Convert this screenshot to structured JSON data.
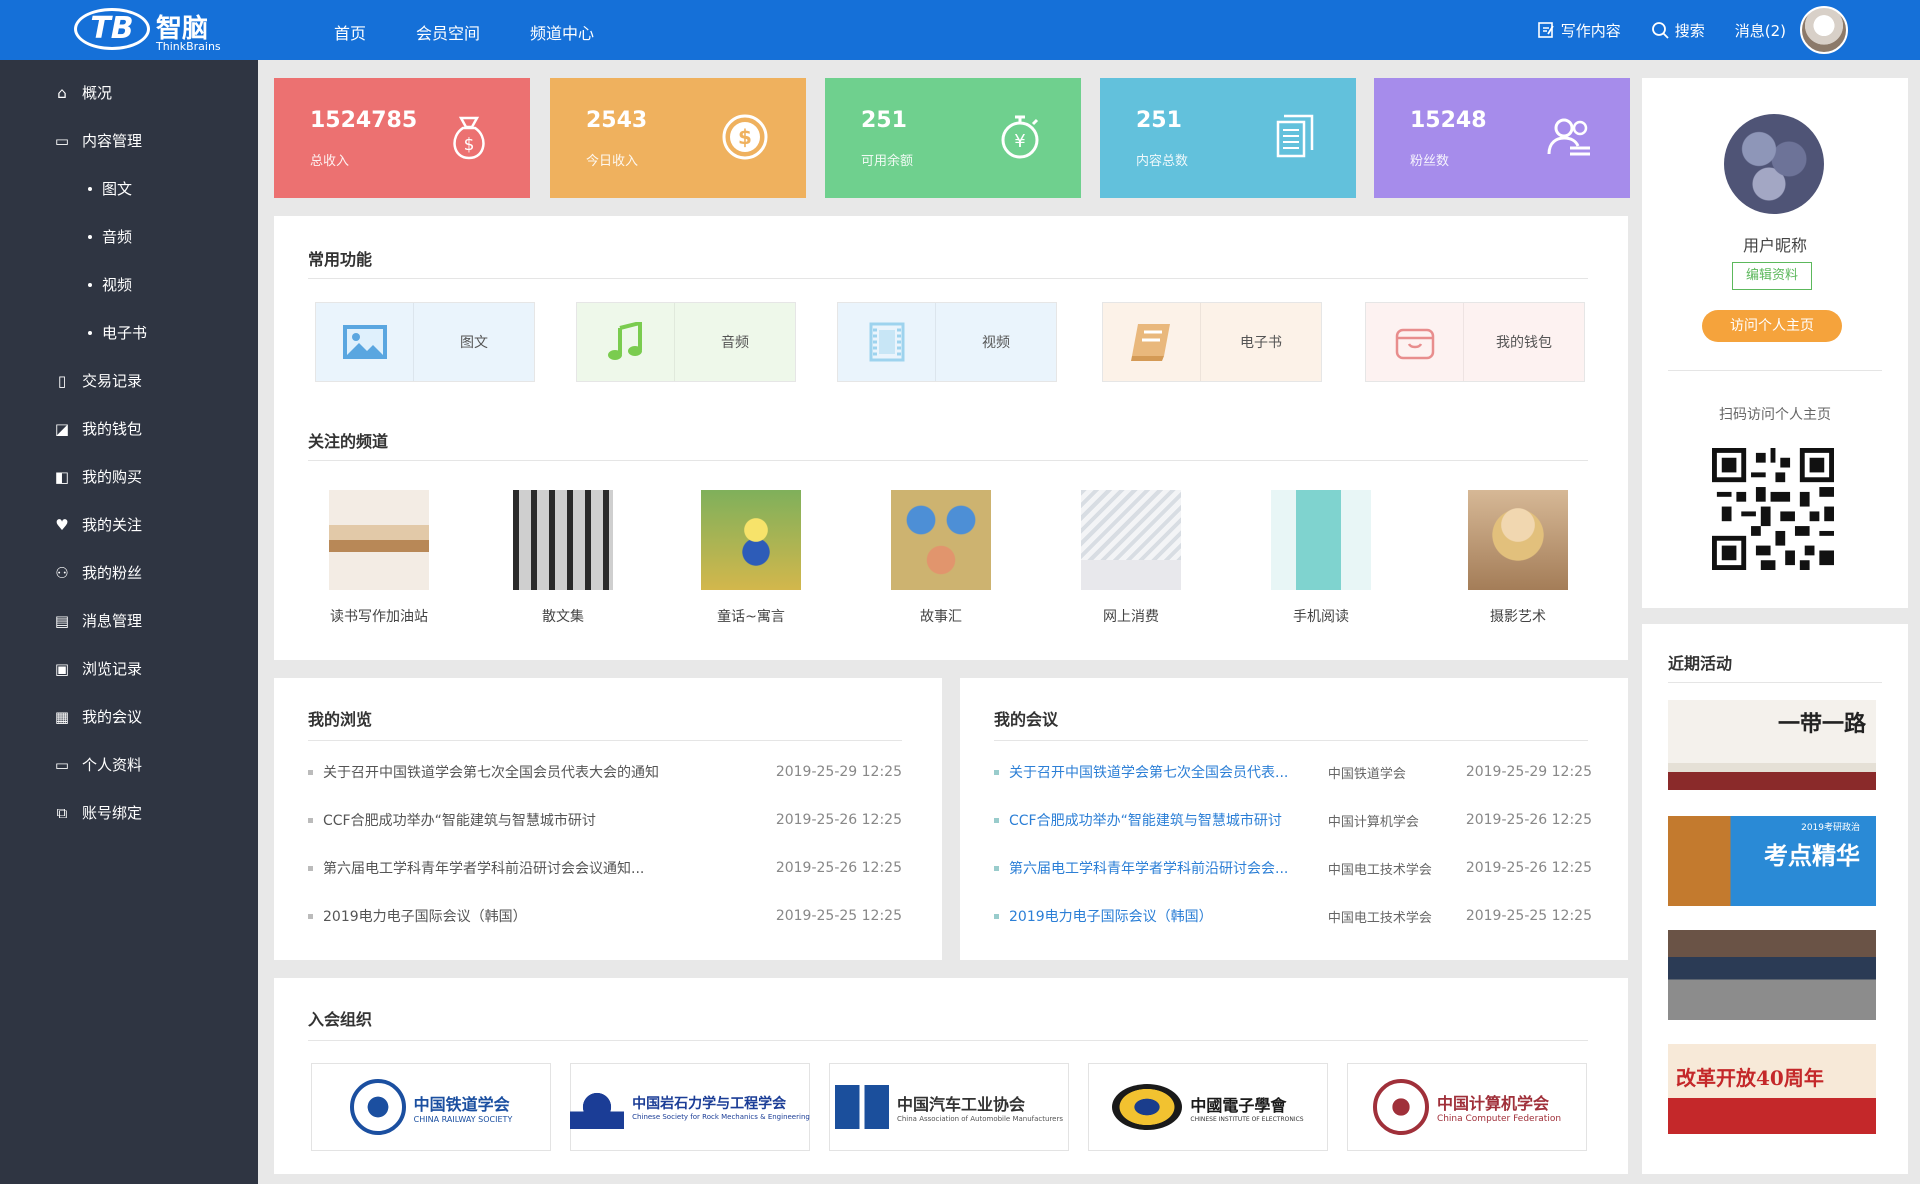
{
  "header": {
    "logo_mark": "TB",
    "logo_cn": "智脑",
    "logo_en": "ThinkBrains",
    "nav": [
      "首页",
      "会员空间",
      "频道中心"
    ],
    "write_label": "写作内容",
    "search_label": "搜索",
    "messages_label": "消息(2)"
  },
  "sidebar": {
    "items": [
      {
        "label": "概况",
        "icon": "home-icon"
      },
      {
        "label": "内容管理",
        "icon": "book-icon"
      },
      {
        "label": "图文",
        "sub": true
      },
      {
        "label": "音频",
        "sub": true
      },
      {
        "label": "视频",
        "sub": true
      },
      {
        "label": "电子书",
        "sub": true
      },
      {
        "label": "交易记录",
        "icon": "receipt-icon"
      },
      {
        "label": "我的钱包",
        "icon": "wallet-icon"
      },
      {
        "label": "我的购买",
        "icon": "purchase-icon"
      },
      {
        "label": "我的关注",
        "icon": "heart-icon"
      },
      {
        "label": "我的粉丝",
        "icon": "fans-icon"
      },
      {
        "label": "消息管理",
        "icon": "message-icon"
      },
      {
        "label": "浏览记录",
        "icon": "history-icon"
      },
      {
        "label": "我的会议",
        "icon": "calendar-icon"
      },
      {
        "label": "个人资料",
        "icon": "id-card-icon"
      },
      {
        "label": "账号绑定",
        "icon": "link-icon"
      }
    ]
  },
  "stats": [
    {
      "value": "1524785",
      "label": "总收入",
      "color": "#ec7171",
      "icon": "money-bag-icon"
    },
    {
      "value": "2543",
      "label": "今日收入",
      "color": "#efb15e",
      "icon": "dollar-coin-icon"
    },
    {
      "value": "251",
      "label": "可用余额",
      "color": "#6fd08e",
      "icon": "yuan-timer-icon"
    },
    {
      "value": "251",
      "label": "内容总数",
      "color": "#62c1dc",
      "icon": "documents-icon"
    },
    {
      "value": "15248",
      "label": "粉丝数",
      "color": "#a68ceb",
      "icon": "users-icon"
    }
  ],
  "functions": {
    "title": "常用功能",
    "items": [
      {
        "label": "图文",
        "icon": "image-icon",
        "bg": "#eaf4fc"
      },
      {
        "label": "音频",
        "icon": "music-icon",
        "bg": "#eef8ea"
      },
      {
        "label": "视频",
        "icon": "film-icon",
        "bg": "#eaf4fc"
      },
      {
        "label": "电子书",
        "icon": "ebook-icon",
        "bg": "#fcf2e8"
      },
      {
        "label": "我的钱包",
        "icon": "wallet-icon",
        "bg": "#fdf2f1"
      }
    ]
  },
  "channels": {
    "title": "关注的频道",
    "items": [
      "读书写作加油站",
      "散文集",
      "童话~寓言",
      "故事汇",
      "网上消费",
      "手机阅读",
      "摄影艺术"
    ]
  },
  "browse": {
    "title": "我的浏览",
    "rows": [
      {
        "title": "关于召开中国铁道学会第七次全国会员代表大会的通知",
        "date": "2019-25-29 12:25"
      },
      {
        "title": "CCF合肥成功举办“智能建筑与智慧城市研讨",
        "date": "2019-25-26 12:25"
      },
      {
        "title": "第六届电工学科青年学者学科前沿研讨会会议通知...",
        "date": "2019-25-26 12:25"
      },
      {
        "title": "2019电力电子国际会议（韩国）",
        "date": "2019-25-25 12:25"
      }
    ]
  },
  "meetings": {
    "title": "我的会议",
    "rows": [
      {
        "title": "关于召开中国铁道学会第七次全国会员代表...",
        "org": "中国铁道学会",
        "date": "2019-25-29 12:25"
      },
      {
        "title": "CCF合肥成功举办“智能建筑与智慧城市研讨",
        "org": "中国计算机学会",
        "date": "2019-25-26 12:25"
      },
      {
        "title": "第六届电工学科青年学者学科前沿研讨会会...",
        "org": "中国电工技术学会",
        "date": "2019-25-26 12:25"
      },
      {
        "title": "2019电力电子国际会议（韩国）",
        "org": "中国电工技术学会",
        "date": "2019-25-25 12:25"
      }
    ]
  },
  "orgs": {
    "title": "入会组织",
    "items": [
      {
        "name": "中国铁道学会",
        "en": "CHINA RAILWAY SOCIETY",
        "color": "#1b4fa0"
      },
      {
        "name": "中国岩石力学与工程学会",
        "en": "Chinese Society for Rock Mechanics & Engineering",
        "color": "#1b3d96"
      },
      {
        "name": "中国汽车工业协会",
        "en": "China Association of Automobile Manufacturers",
        "color": "#333"
      },
      {
        "name": "中國電子學會",
        "en": "CHINESE INSTITUTE OF ELECTRONICS",
        "color": "#1a1a1a"
      },
      {
        "name": "中国计算机学会",
        "en": "China Computer Federation",
        "color": "#a0303a"
      }
    ]
  },
  "profile": {
    "nickname": "用户昵称",
    "edit_label": "编辑资料",
    "visit_label": "访问个人主页",
    "qr_caption": "扫码访问个人主页"
  },
  "activities": {
    "title": "近期活动",
    "banners": [
      {
        "text": "一带一路"
      },
      {
        "text": "考点精华",
        "sub": "2019考研政治"
      },
      {
        "text": ""
      },
      {
        "text": "改革开放40周年"
      }
    ]
  }
}
